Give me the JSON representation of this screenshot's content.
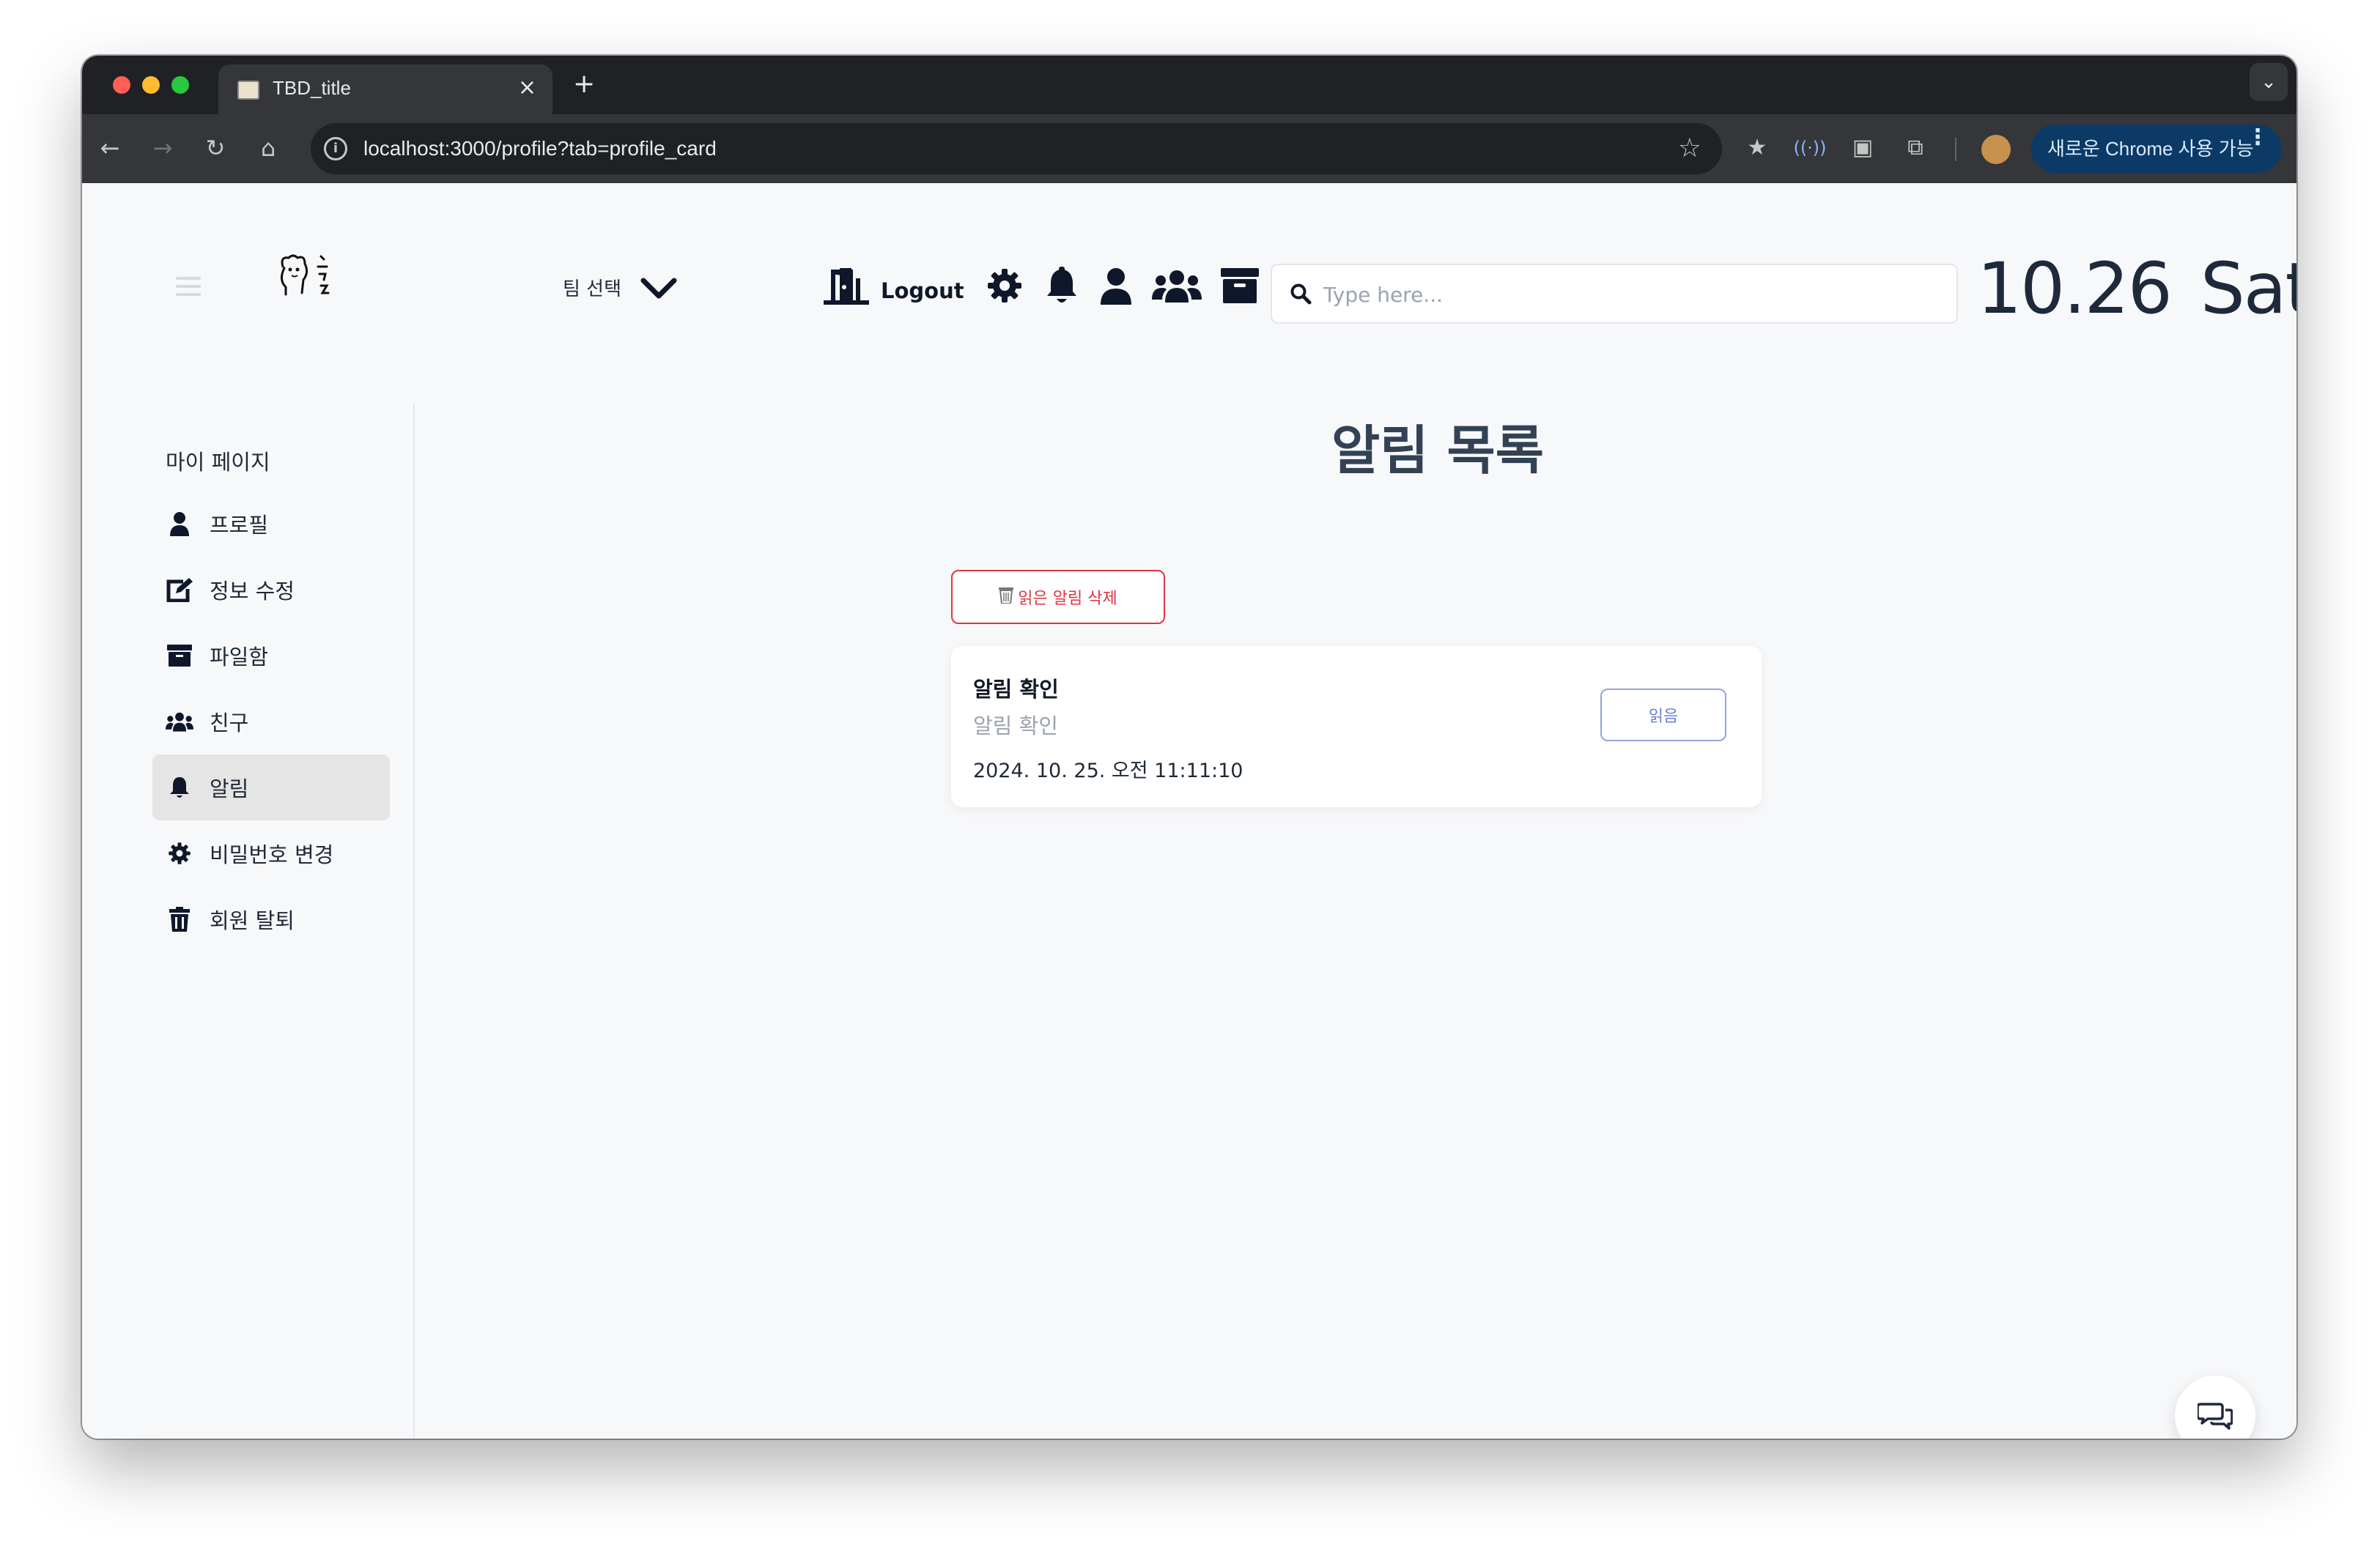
{
  "browser": {
    "tab_title": "TBD_title",
    "tab_close": "×",
    "new_tab": "+",
    "url": "localhost:3000/profile?tab=profile_card",
    "update_label": "새로운 Chrome 사용 가능",
    "update_menu": "⋮"
  },
  "header": {
    "team_select_label": "팀 선택",
    "logout_label": "Logout",
    "search_placeholder": "Type here...",
    "date_day": "10.26",
    "date_weekday": "Sat"
  },
  "sidebar": {
    "title": "마이 페이지",
    "items": [
      {
        "label": "프로필",
        "icon": "user-icon"
      },
      {
        "label": "정보 수정",
        "icon": "edit-icon"
      },
      {
        "label": "파일함",
        "icon": "archive-icon"
      },
      {
        "label": "친구",
        "icon": "users-icon"
      },
      {
        "label": "알림",
        "icon": "bell-icon",
        "active": true
      },
      {
        "label": "비밀번호 변경",
        "icon": "gear-icon"
      },
      {
        "label": "회원 탈퇴",
        "icon": "trash-icon"
      }
    ]
  },
  "main": {
    "title": "알림 목록",
    "delete_read_label": "읽은 알림 삭제",
    "notifications": [
      {
        "title": "알림 확인",
        "body": "알림 확인",
        "time": "2024. 10. 25. 오전 11:11:10",
        "action_label": "읽음"
      }
    ]
  },
  "colors": {
    "accent_danger": "#dc3545",
    "accent_read": "#6b7fd7",
    "text_dark": "#0f172a",
    "chrome_update_pill": "#0b3a66"
  }
}
